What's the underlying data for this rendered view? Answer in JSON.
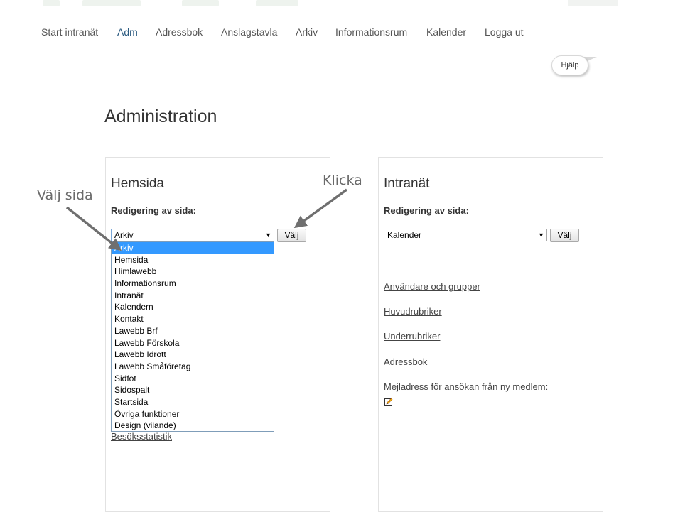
{
  "nav": {
    "items": [
      {
        "label": "Start intranät"
      },
      {
        "label": "Adm"
      },
      {
        "label": "Adressbok"
      },
      {
        "label": "Anslagstavla"
      },
      {
        "label": "Arkiv"
      },
      {
        "label": "Informationsrum"
      },
      {
        "label": "Kalender"
      },
      {
        "label": "Logga ut"
      }
    ],
    "active": "Adm"
  },
  "help": {
    "label": "Hjälp"
  },
  "page": {
    "title": "Administration"
  },
  "hemsida": {
    "title": "Hemsida",
    "edit_label": "Redigering av sida:",
    "selected": "Arkiv",
    "button": "Välj",
    "options": [
      "Arkiv",
      "Hemsida",
      "Himlawebb",
      "Informationsrum",
      "Intranät",
      "Kalendern",
      "Kontakt",
      "Lawebb Brf",
      "Lawebb Förskola",
      "Lawebb Idrott",
      "Lawebb Småföretag",
      "Sidfot",
      "Sidospalt",
      "Startsida",
      "Övriga funktioner",
      "Design (vilande)"
    ],
    "stats_link": "Besöksstatistik"
  },
  "intranat": {
    "title": "Intranät",
    "edit_label": "Redigering av sida:",
    "selected": "Kalender",
    "button": "Välj",
    "links": [
      "Användare och grupper",
      "Huvudrubriker",
      "Underrubriker",
      "Adressbok"
    ],
    "mail_label": "Mejladress för ansökan från ny medlem:"
  },
  "annotations": {
    "select_page": "Välj sida",
    "click": "Klicka"
  },
  "colors": {
    "accent": "#2a5a80",
    "selection": "#3399ff",
    "arrow": "#6f6f6f"
  },
  "icons": {
    "edit": "pencil-edit-icon",
    "dropdown": "chevron-down-icon"
  }
}
